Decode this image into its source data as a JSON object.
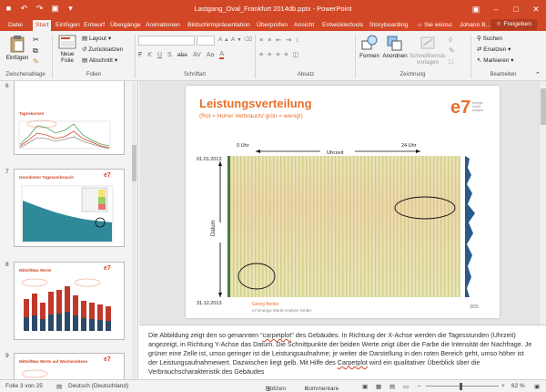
{
  "window": {
    "title": "Lastgang_Oval_Frankfurt 2014db.pptx - PowerPoint"
  },
  "tabs": {
    "file": "Datei",
    "items": [
      "Start",
      "Einfügen",
      "Entwurf",
      "Übergänge",
      "Animationen",
      "Bildschirmpräsentation",
      "Überprüfen",
      "Ansicht",
      "Entwicklertools",
      "Storyboarding"
    ],
    "tell_me": "Sie wünsc",
    "user": "Johann B...",
    "share": "Freigeben"
  },
  "ribbon": {
    "paste": "Einfügen",
    "new_slide_line1": "Neue",
    "new_slide_line2": "Folie",
    "layout": "Layout",
    "reset": "Zurücksetzen",
    "section": "Abschnitt",
    "shapes": "Formen",
    "arrange": "Anordnen",
    "quick_styles_line1": "Schnellformat-",
    "quick_styles_line2": "vorlagen",
    "find": "Suchen",
    "replace": "Ersetzen",
    "select": "Markieren",
    "groups": {
      "clipboard": "Zwischenablage",
      "slides": "Folien",
      "font": "Schriftart",
      "paragraph": "Absatz",
      "drawing": "Zeichnung",
      "editing": "Bearbeiten"
    }
  },
  "thumbnails": [
    {
      "num": "6",
      "title": "Tageskurven"
    },
    {
      "num": "7",
      "title": "Geordneter Tagesverbrauch"
    },
    {
      "num": "8",
      "title": "Mittel/Max Werte"
    },
    {
      "num": "9",
      "title": "Mittel/Max Werte auf Wochenebene"
    }
  ],
  "slide": {
    "title": "Leistungsverteilung",
    "subtitle": "(Rot  = Hoher Verbrauch/ grün = wenig!)",
    "start_time": "0 Uhr",
    "axis_time": "Uhrzeit",
    "end_time": "24 Uhr",
    "start_date": "01.01.2013",
    "axis_date": "Datum",
    "end_date": "31.12.2013",
    "footer_name": "Georg Benke",
    "footer_company": "e7 Energie Markt Analyse GmbH",
    "page": "3/25",
    "logo_text": "e7",
    "logo_line1": "energie",
    "logo_line2": "markt",
    "logo_line3": "analyse"
  },
  "notes": {
    "part1": "Die Abbildung zeigt den so genannten \"",
    "term1": "carpetplot",
    "part2": "\" des Gebäudes. In Richtung der X-Achse werden die Tagesstunden (Uhrzeit) angezeigt, in Richtung Y-Achse das Datum. Die Schnittpunkte der beiden Werte zeigt über die Farbe die Intensität der Nachfrage. Je grüner eine Zelle ist, umso geringer ist die Leistungsaufnahme; je weiter die Darstellung in den roten Bereich geht, umso höher ist der Leistungsaufnahmewert. Dazwischen liegt gelb. Mit Hilfe des ",
    "term2": "Carpetplot",
    "part3": " wird ein qualitativer Überblick über die Verbrauchscharakteristik des Gebäudes"
  },
  "status": {
    "slide_info": "Folie 3 von 25",
    "language": "Deutsch (Deutschland)",
    "notes": "Notizen",
    "comments": "Kommentare",
    "zoom": "62 %"
  },
  "colors": {
    "accent": "#d24726",
    "slide_orange": "#e8702a",
    "carpet_green": "#c8d98a",
    "carpet_red": "#f2a58a"
  }
}
